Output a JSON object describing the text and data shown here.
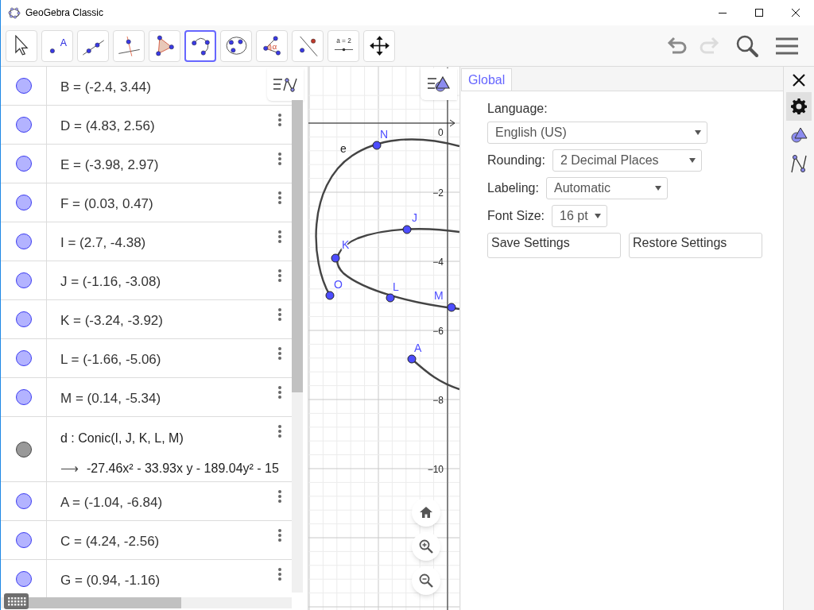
{
  "window": {
    "title": "GeoGebra Classic"
  },
  "toolbar": {
    "tools": [
      {
        "kind": "move",
        "selected": false
      },
      {
        "kind": "point",
        "selected": false,
        "text": "A"
      },
      {
        "kind": "line",
        "selected": false
      },
      {
        "kind": "perpendicular",
        "selected": false
      },
      {
        "kind": "polygon",
        "selected": false
      },
      {
        "kind": "arc",
        "selected": true
      },
      {
        "kind": "conic",
        "selected": false
      },
      {
        "kind": "angle",
        "selected": false,
        "text": "α"
      },
      {
        "kind": "reflect",
        "selected": false
      },
      {
        "kind": "slider",
        "selected": false,
        "text": "a = 2"
      },
      {
        "kind": "pan",
        "selected": false
      }
    ],
    "undo": {
      "disabled": false
    },
    "redo": {
      "disabled": true
    }
  },
  "algebra": {
    "items": [
      {
        "kind": "point",
        "color": "#b3b3ff",
        "text": "B = (-2.4, 3.44)",
        "menu": false
      },
      {
        "kind": "point",
        "color": "#b3b3ff",
        "text": "D = (4.83, 2.56)",
        "menu": true
      },
      {
        "kind": "point",
        "color": "#b3b3ff",
        "text": "E = (-3.98, 2.97)",
        "menu": true
      },
      {
        "kind": "point",
        "color": "#b3b3ff",
        "text": "F = (0.03, 0.47)",
        "menu": true
      },
      {
        "kind": "point",
        "color": "#b3b3ff",
        "text": "I = (2.7, -4.38)",
        "menu": true
      },
      {
        "kind": "point",
        "color": "#b3b3ff",
        "text": "J = (-1.16, -3.08)",
        "menu": true
      },
      {
        "kind": "point",
        "color": "#b3b3ff",
        "text": "K = (-3.24, -3.92)",
        "menu": true
      },
      {
        "kind": "point",
        "color": "#b3b3ff",
        "text": "L = (-1.66, -5.06)",
        "menu": true
      },
      {
        "kind": "point",
        "color": "#b3b3ff",
        "text": "M = (0.14, -5.34)",
        "menu": true
      },
      {
        "kind": "conic",
        "color": "#999999",
        "text": "d : Conic(I, J, K, L, M)",
        "arrow": "⟶",
        "output": "-27.46x² - 33.93x y - 189.04y² - 15",
        "menu": true
      },
      {
        "kind": "point",
        "color": "#b3b3ff",
        "text": "A = (-1.04, -6.84)",
        "menu": true
      },
      {
        "kind": "point",
        "color": "#b3b3ff",
        "text": "C = (4.24, -2.56)",
        "menu": true
      },
      {
        "kind": "point",
        "color": "#b3b3ff",
        "text": "G = (0.94, -1.16)",
        "menu": true
      }
    ]
  },
  "graphics": {
    "y_tick_labels": [
      "−2",
      "−4",
      "−6",
      "−8",
      "−10"
    ],
    "origin_label": "0",
    "curve_label": "e",
    "points": [
      {
        "name": "N"
      },
      {
        "name": "J"
      },
      {
        "name": "K"
      },
      {
        "name": "O"
      },
      {
        "name": "L"
      },
      {
        "name": "M"
      },
      {
        "name": "A"
      }
    ]
  },
  "settings": {
    "tabs": [
      {
        "label": "Global",
        "selected": true
      }
    ],
    "language": {
      "label": "Language:",
      "value": "English (US)"
    },
    "rounding": {
      "label": "Rounding:",
      "value": "2 Decimal Places"
    },
    "labeling": {
      "label": "Labeling:",
      "value": "Automatic"
    },
    "font_size": {
      "label": "Font Size:",
      "value": "16 pt"
    },
    "buttons": [
      "Save Settings",
      "Restore Settings"
    ],
    "side": [
      {
        "kind": "global",
        "selected": true
      },
      {
        "kind": "graphics",
        "selected": false
      },
      {
        "kind": "algebra",
        "selected": false
      }
    ]
  }
}
